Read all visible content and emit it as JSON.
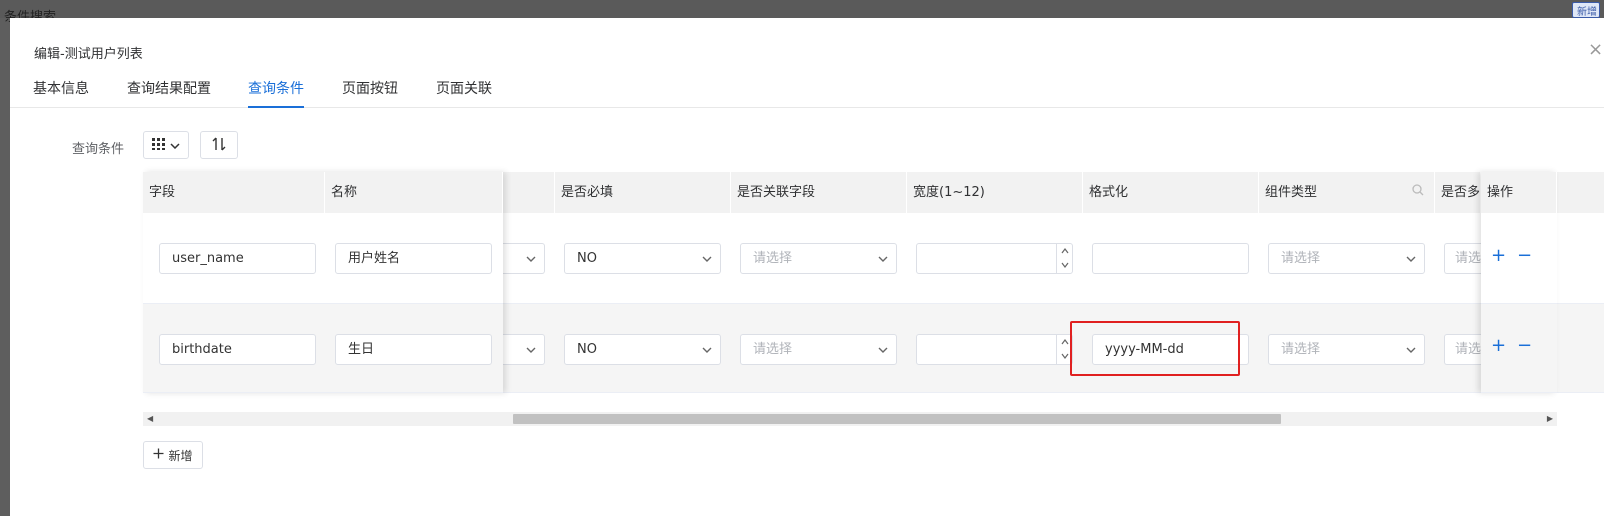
{
  "background": {
    "title": "条件搜索",
    "button_label": "新增"
  },
  "modal": {
    "title": "编辑-测试用户列表"
  },
  "tabs": [
    {
      "label": "基本信息"
    },
    {
      "label": "查询结果配置"
    },
    {
      "label": "查询条件"
    },
    {
      "label": "页面按钮"
    },
    {
      "label": "页面关联"
    }
  ],
  "query_conditions_label": "查询条件",
  "table": {
    "headers": {
      "field": "字段",
      "name": "名称",
      "required": "是否必填",
      "related_field": "是否关联字段",
      "width": "宽度(1~12)",
      "format": "格式化",
      "component_type": "组件类型",
      "multi": "是否多",
      "actions": "操作"
    },
    "rows": [
      {
        "field": "user_name",
        "name": "用户姓名",
        "required": "NO",
        "related_placeholder": "请选择",
        "width": "",
        "format": "",
        "component_placeholder": "请选择",
        "multi_placeholder": "请选"
      },
      {
        "field": "birthdate",
        "name": "生日",
        "required": "NO",
        "related_placeholder": "请选择",
        "width": "",
        "format": "yyyy-MM-dd",
        "component_placeholder": "请选择",
        "multi_placeholder": "请选"
      }
    ],
    "op_add": "+",
    "op_remove": "−"
  },
  "add_button_label": "新增",
  "icons": {
    "grid": "grid-icon",
    "sort": "sort-icon",
    "close": "close-icon",
    "search": "search-icon"
  },
  "colors": {
    "accent": "#1a6fd8",
    "highlight": "#e02020"
  }
}
